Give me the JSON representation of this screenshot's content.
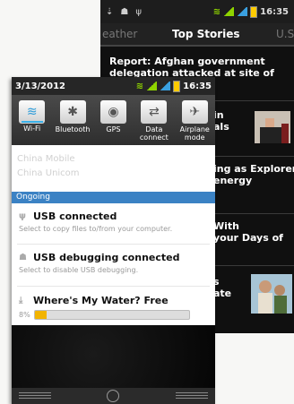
{
  "back_phone": {
    "status_bar": {
      "left_icons": [
        "usb-icon",
        "android-debug-icon",
        "usb-icon"
      ],
      "time": "16:35"
    },
    "tabs": [
      "eather",
      "Top Stories",
      "U.S"
    ],
    "stories": [
      {
        "text": "Report: Afghan government delegation attacked at site of US"
      },
      {
        "text": "in\nals",
        "has_thumb": true
      },
      {
        "text": "ing as Explorers\nenergy"
      },
      {
        "text": "With\nyour Days of"
      },
      {
        "text": "s\nate",
        "has_thumb": true
      }
    ]
  },
  "front_phone": {
    "status_bar": {
      "date": "3/13/2012",
      "time": "16:35"
    },
    "toggles": [
      {
        "label": "Wi-Fi",
        "icon": "wifi-icon",
        "glyph": "≋",
        "active": true
      },
      {
        "label": "Bluetooth",
        "icon": "bluetooth-icon",
        "glyph": "✱",
        "active": false
      },
      {
        "label": "GPS",
        "icon": "gps-icon",
        "glyph": "◉",
        "active": false
      },
      {
        "label": "Data connect",
        "icon": "data-connection-icon",
        "glyph": "⇄",
        "active": false
      },
      {
        "label": "Airplane mode",
        "icon": "airplane-icon",
        "glyph": "✈",
        "active": false
      }
    ],
    "carriers": [
      "China Mobile",
      "China Unicom"
    ],
    "section_header": "Ongoing",
    "notifications": [
      {
        "icon": "usb-icon",
        "title": "USB connected",
        "subtitle": "Select to copy files to/from your computer."
      },
      {
        "icon": "android-debug-icon",
        "title": "USB debugging connected",
        "subtitle": "Select to disable USB debugging."
      }
    ],
    "download": {
      "icon": "download-icon",
      "title": "Where's My Water? Free",
      "percent_label": "8%",
      "progress": 0.08
    }
  }
}
